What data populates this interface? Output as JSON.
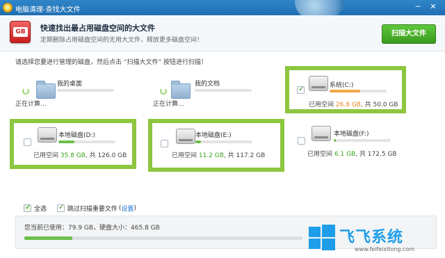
{
  "window": {
    "title": "电脑清理-查找大文件"
  },
  "header": {
    "icon_label": "GB",
    "title": "快速找出最占用磁盘空间的大文件",
    "subtitle": "定期删除占用磁盘空间的无用大文件，释放更多磁盘空间！",
    "scan_button": "扫描大文件"
  },
  "instruction": "请选择您要进行管理的磁盘，然后点击 “扫描大文件” 按钮进行扫描！",
  "drives": [
    {
      "name": "我的桌面",
      "status": "正在计算...",
      "checked": false,
      "loading": true,
      "fill": 0,
      "used_label": "",
      "used": "",
      "total_label": ""
    },
    {
      "name": "我的文档",
      "status": "正在计算...",
      "checked": false,
      "loading": true,
      "fill": 0,
      "used_label": "",
      "used": "",
      "total_label": ""
    },
    {
      "name": "系统(C:)",
      "status": "",
      "checked": true,
      "loading": false,
      "fill": 0.536,
      "used_label": "已用空间",
      "used": "26.8 GB",
      "total_label": ", 共 50.0 GB"
    },
    {
      "name": "本地磁盘(D:)",
      "status": "",
      "checked": false,
      "loading": false,
      "fill": 0.284,
      "used_label": "已用空间",
      "used": "35.8 GB",
      "total_label": ", 共 126.0 GB"
    },
    {
      "name": "本地磁盘(E:)",
      "status": "",
      "checked": false,
      "loading": false,
      "fill": 0.096,
      "used_label": "已用空间",
      "used": "11.2 GB",
      "total_label": ", 共 117.2 GB"
    },
    {
      "name": "本地磁盘(F:)",
      "status": "",
      "checked": false,
      "loading": false,
      "fill": 0.035,
      "used_label": "已用空间",
      "used": "6.1 GB",
      "total_label": ", 共 172.5 GB"
    }
  ],
  "options": {
    "select_all": "全选",
    "skip_important": "跳过扫描重要文件",
    "open_paren": "(",
    "settings_link": "设置",
    "close_paren": ")"
  },
  "usage": {
    "text": "您当前已使用：79.9 GB，硬盘大小：465.8 GB",
    "fraction": 0.172
  },
  "watermark": {
    "brand": "飞飞系统",
    "url": "www.feifeixitong.com"
  },
  "colors": {
    "accent_green": "#8dc63f",
    "bar_green": "#6cc04a",
    "bar_orange": "#f0a94a",
    "link_blue": "#1f6fd1"
  }
}
